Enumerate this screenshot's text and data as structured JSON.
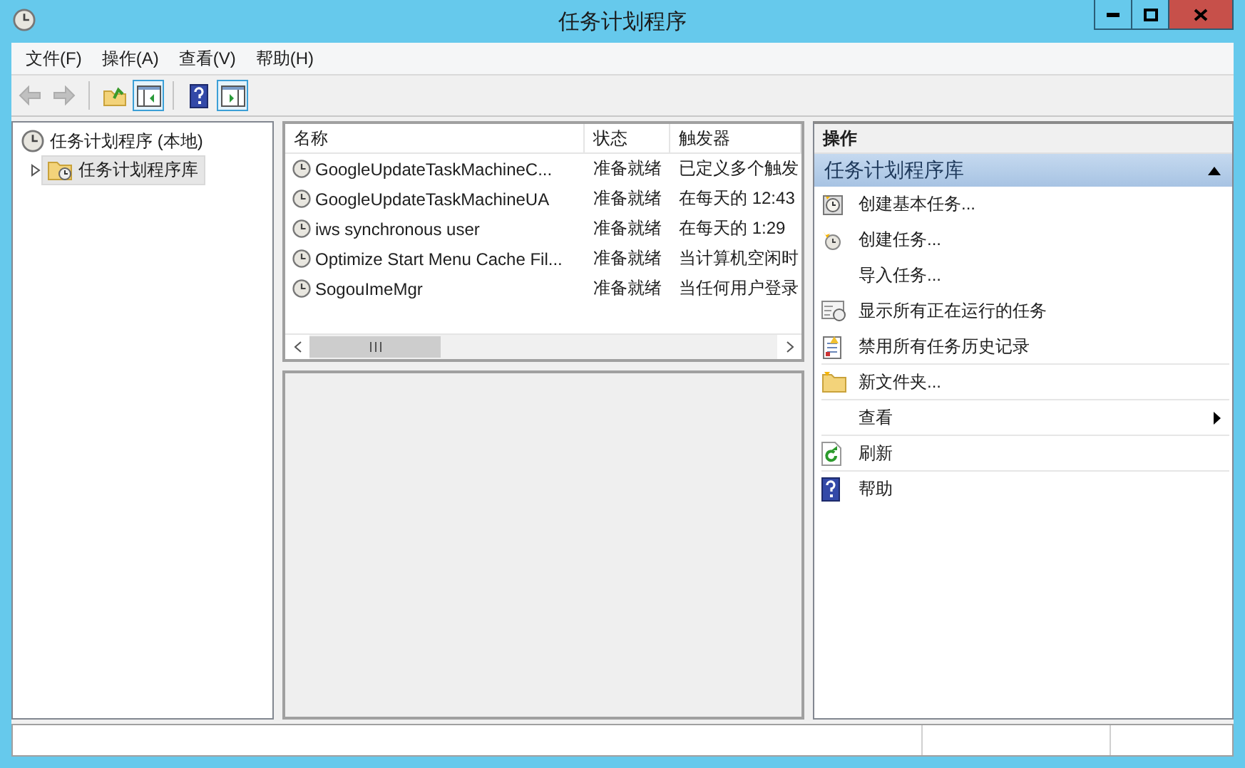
{
  "window": {
    "title": "任务计划程序"
  },
  "menu": [
    "文件(F)",
    "操作(A)",
    "查看(V)",
    "帮助(H)"
  ],
  "toolbar": [
    {
      "kind": "back",
      "disabled": true,
      "pressed": false
    },
    {
      "kind": "forward",
      "disabled": true,
      "pressed": false
    },
    {
      "kind": "up",
      "disabled": false,
      "pressed": false
    },
    {
      "kind": "tree",
      "disabled": false,
      "pressed": true
    },
    {
      "kind": "help",
      "disabled": false,
      "pressed": false
    },
    {
      "kind": "actionpane",
      "disabled": false,
      "pressed": true
    }
  ],
  "tree": [
    {
      "label": "任务计划程序 (本地)",
      "selected": false,
      "expanded": true,
      "children": [
        {
          "label": "任务计划程序库",
          "selected": true,
          "expanded": false
        }
      ]
    }
  ],
  "table": {
    "columns": [
      "名称",
      "状态",
      "触发器"
    ],
    "rows": [
      [
        "GoogleUpdateTaskMachineC...",
        "准备就绪",
        "已定义多个触发"
      ],
      [
        "GoogleUpdateTaskMachineUA",
        "准备就绪",
        "在每天的 12:43"
      ],
      [
        "iws synchronous user",
        "准备就绪",
        "在每天的 1:29"
      ],
      [
        "Optimize Start Menu Cache Fil...",
        "准备就绪",
        "当计算机空闲时"
      ],
      [
        "SogouImeMgr",
        "准备就绪",
        "当任何用户登录"
      ]
    ]
  },
  "actions": {
    "title": "操作",
    "section": {
      "title": "任务计划程序库",
      "expanded": true
    },
    "items": [
      {
        "label": "创建基本任务...",
        "kind": "wizard",
        "submenu": false,
        "separator": false
      },
      {
        "label": "创建任务...",
        "kind": "newtask",
        "submenu": false,
        "separator": false
      },
      {
        "label": "导入任务...",
        "kind": "plain",
        "submenu": false,
        "separator": false
      },
      {
        "label": "显示所有正在运行的任务",
        "kind": "running",
        "submenu": false,
        "separator": false
      },
      {
        "label": "禁用所有任务历史记录",
        "kind": "history",
        "submenu": false,
        "separator": true
      },
      {
        "label": "新文件夹...",
        "kind": "folder",
        "submenu": false,
        "separator": true
      },
      {
        "label": "查看",
        "kind": "plain",
        "submenu": true,
        "separator": true
      },
      {
        "label": "刷新",
        "kind": "refresh",
        "submenu": false,
        "separator": true
      },
      {
        "label": "帮助",
        "kind": "help",
        "submenu": false,
        "separator": false
      }
    ]
  }
}
